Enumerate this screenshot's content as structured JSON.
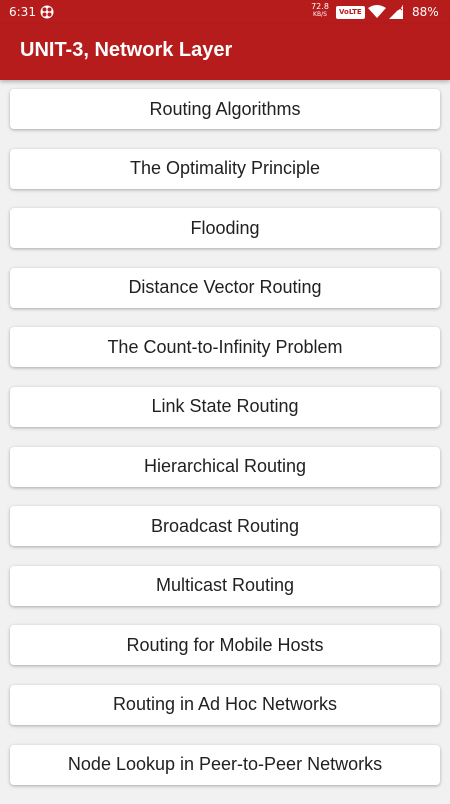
{
  "status_bar": {
    "time": "6:31",
    "net_speed_value": "72.8",
    "net_speed_unit": "KB/S",
    "volte_label": "VoLTE",
    "battery_percent": "88%",
    "app_icon": "app-notification-icon",
    "wifi_icon": "wifi-icon",
    "signal_icon": "signal-icon"
  },
  "app_bar": {
    "title": "UNIT-3, Network Layer",
    "color": "#b71c1c"
  },
  "topics": [
    {
      "label": "Routing Algorithms"
    },
    {
      "label": "The Optimality Principle"
    },
    {
      "label": "Flooding"
    },
    {
      "label": "Distance Vector Routing"
    },
    {
      "label": "The Count-to-Infinity Problem"
    },
    {
      "label": "Link State Routing"
    },
    {
      "label": "Hierarchical Routing"
    },
    {
      "label": "Broadcast Routing"
    },
    {
      "label": "Multicast Routing"
    },
    {
      "label": "Routing for Mobile Hosts"
    },
    {
      "label": "Routing in Ad Hoc Networks"
    },
    {
      "label": "Node Lookup in Peer-to-Peer Networks"
    }
  ]
}
